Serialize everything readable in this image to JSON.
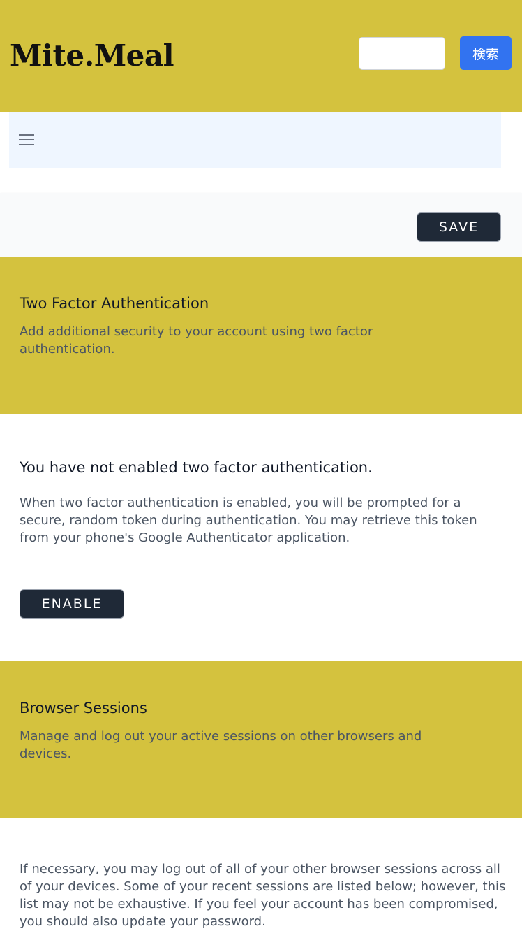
{
  "header": {
    "logo": "Mite.Meal",
    "search_placeholder": "",
    "search_button": "検索",
    "background": "#d4c23e",
    "search_button_color": "#3273f0"
  },
  "nav": {
    "menu_icon": "hamburger-menu-icon"
  },
  "save_bar": {
    "save_label": "SAVE"
  },
  "two_factor": {
    "title": "Two Factor Authentication",
    "description": "Add additional security to your account using two factor authentication.",
    "status": "You have not enabled two factor authentication.",
    "explanation": "When two factor authentication is enabled, you will be prompted for a secure, random token during authentication. You may retrieve this token from your phone's Google Authenticator application.",
    "enable_label": "ENABLE"
  },
  "browser_sessions": {
    "title": "Browser Sessions",
    "description": "Manage and log out your active sessions on other browsers and devices.",
    "explanation": "If necessary, you may log out of all of your other browser sessions across all of your devices. Some of your recent sessions are listed below; however, this list may not be exhaustive. If you feel your account has been compromised, you should also update your password."
  }
}
